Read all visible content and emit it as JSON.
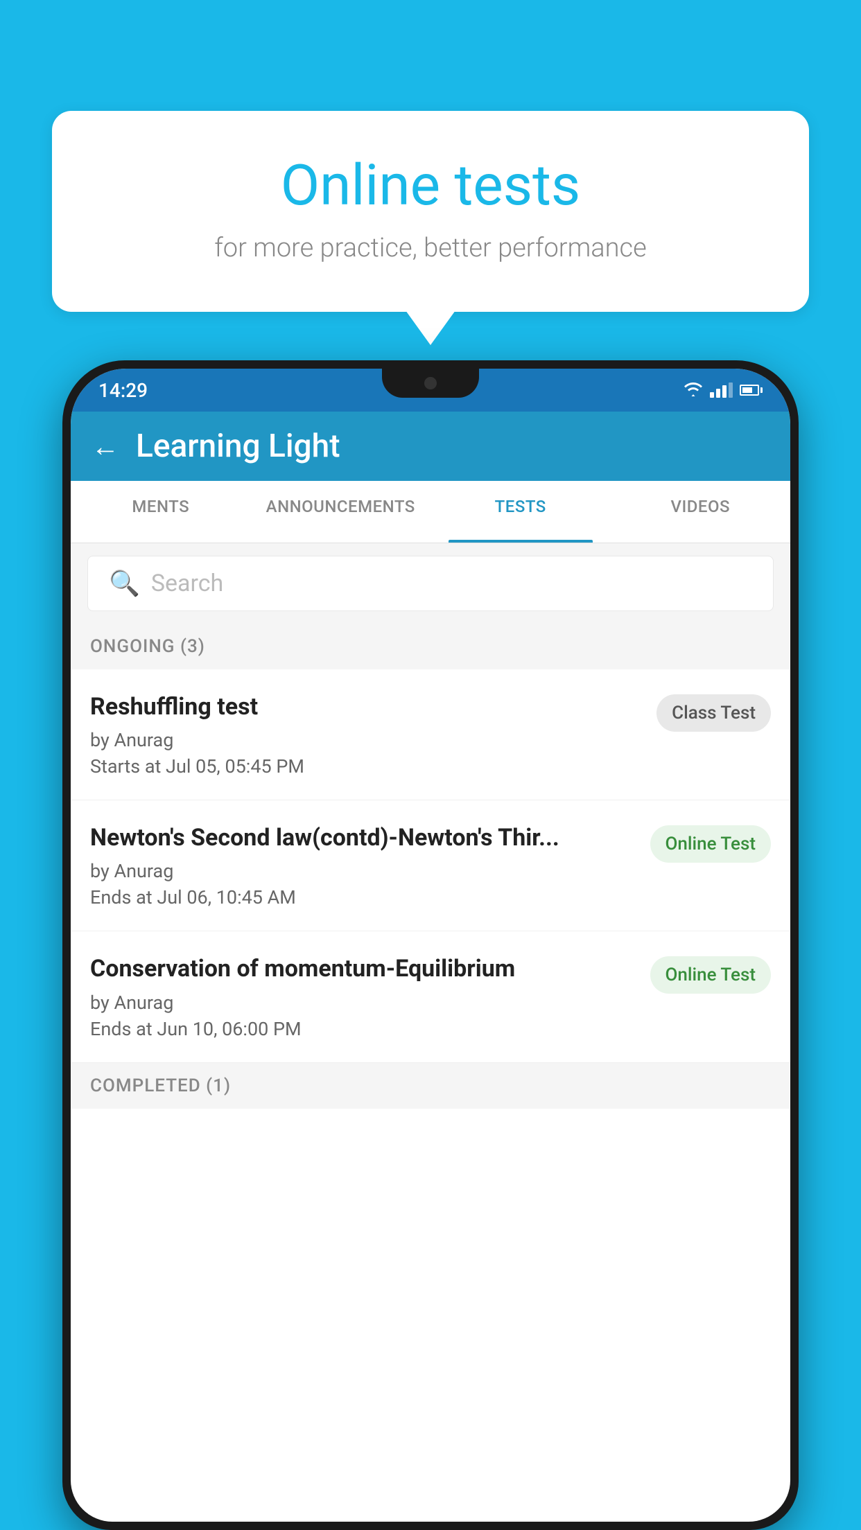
{
  "background": {
    "color": "#1ab8e8"
  },
  "speech_bubble": {
    "title": "Online tests",
    "subtitle": "for more practice, better performance"
  },
  "phone": {
    "status_bar": {
      "time": "14:29"
    },
    "app_bar": {
      "title": "Learning Light",
      "back_label": "←"
    },
    "tabs": [
      {
        "label": "MENTS",
        "active": false
      },
      {
        "label": "ANNOUNCEMENTS",
        "active": false
      },
      {
        "label": "TESTS",
        "active": true
      },
      {
        "label": "VIDEOS",
        "active": false
      }
    ],
    "search": {
      "placeholder": "Search"
    },
    "sections": [
      {
        "label": "ONGOING (3)",
        "tests": [
          {
            "name": "Reshuffling test",
            "author": "by Anurag",
            "date": "Starts at  Jul 05, 05:45 PM",
            "badge": "Class Test",
            "badge_type": "class"
          },
          {
            "name": "Newton's Second law(contd)-Newton's Thir...",
            "author": "by Anurag",
            "date": "Ends at  Jul 06, 10:45 AM",
            "badge": "Online Test",
            "badge_type": "online"
          },
          {
            "name": "Conservation of momentum-Equilibrium",
            "author": "by Anurag",
            "date": "Ends at  Jun 10, 06:00 PM",
            "badge": "Online Test",
            "badge_type": "online"
          }
        ]
      }
    ],
    "completed_label": "COMPLETED (1)"
  }
}
